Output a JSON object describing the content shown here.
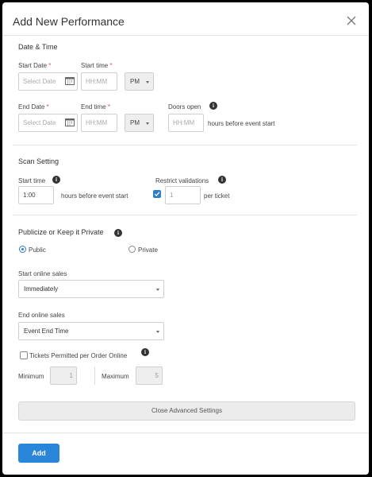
{
  "modal": {
    "title": "Add New Performance"
  },
  "date_time": {
    "section_title": "Date & Time",
    "start_date_label": "Start Date",
    "start_date_placeholder": "Select Date",
    "start_time_label": "Start time",
    "start_time_placeholder": "HH:MM",
    "start_ampm": "PM",
    "end_date_label": "End Date",
    "end_date_placeholder": "Select Date",
    "end_time_label": "End time",
    "end_time_placeholder": "HH:MM",
    "end_ampm": "PM",
    "doors_open_label": "Doors open",
    "doors_open_placeholder": "HH:MM",
    "doors_open_suffix": "hours before event start",
    "required_mark": "*"
  },
  "scan": {
    "section_title": "Scan Setting",
    "start_time_label": "Start time",
    "start_time_value": "1:00",
    "start_time_suffix": "hours before event start",
    "restrict_label": "Restrict validations",
    "restrict_checked": true,
    "restrict_value": "1",
    "restrict_suffix": "per ticket"
  },
  "publicize": {
    "section_title": "Publicize or Keep it Private",
    "public_label": "Public",
    "private_label": "Private",
    "selected": "Public",
    "start_sales_label": "Start online sales",
    "start_sales_value": "Immediately",
    "end_sales_label": "End online sales",
    "end_sales_value": "Event End Time",
    "tickets_permitted_label": "Tickets Permitted per Order Online",
    "tickets_permitted_checked": false,
    "minimum_label": "Minimum",
    "minimum_value": "1",
    "maximum_label": "Maximum",
    "maximum_value": "5"
  },
  "advanced_button": "Close Advanced Settings",
  "footer": {
    "add_button": "Add"
  },
  "colors": {
    "primary": "#2a86db",
    "required": "#d9534f"
  }
}
